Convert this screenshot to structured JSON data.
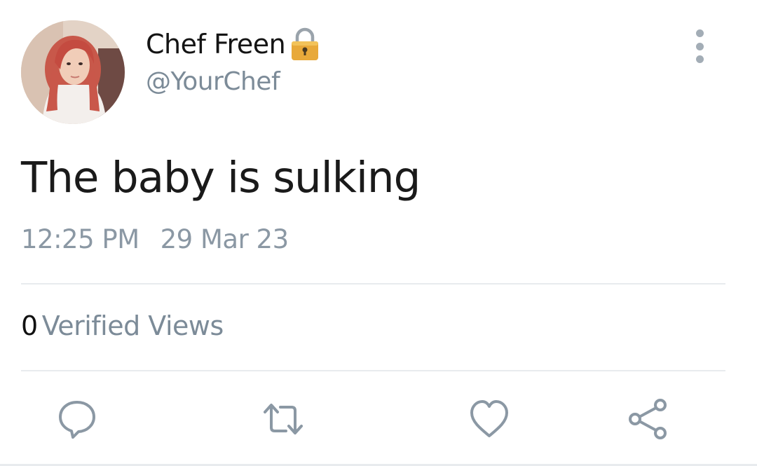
{
  "user": {
    "display_name": "Chef Freen",
    "handle": "@YourChef",
    "avatar_icon": "profile-photo",
    "lock_icon": "lock-icon"
  },
  "tweet": {
    "text": "The baby is sulking",
    "time": "12:25 PM",
    "date": "29 Mar 23"
  },
  "stats": {
    "views_count": "0",
    "views_label": "Verified Views"
  },
  "actions": {
    "reply_icon": "comment-icon",
    "retweet_icon": "retweet-icon",
    "like_icon": "heart-icon",
    "share_icon": "share-icon"
  },
  "colors": {
    "text_primary": "#141414",
    "text_secondary": "#7c8b98",
    "icon_gray": "#8b98a4",
    "lock_gold": "#e8a93a",
    "divider": "#e8ebee"
  }
}
